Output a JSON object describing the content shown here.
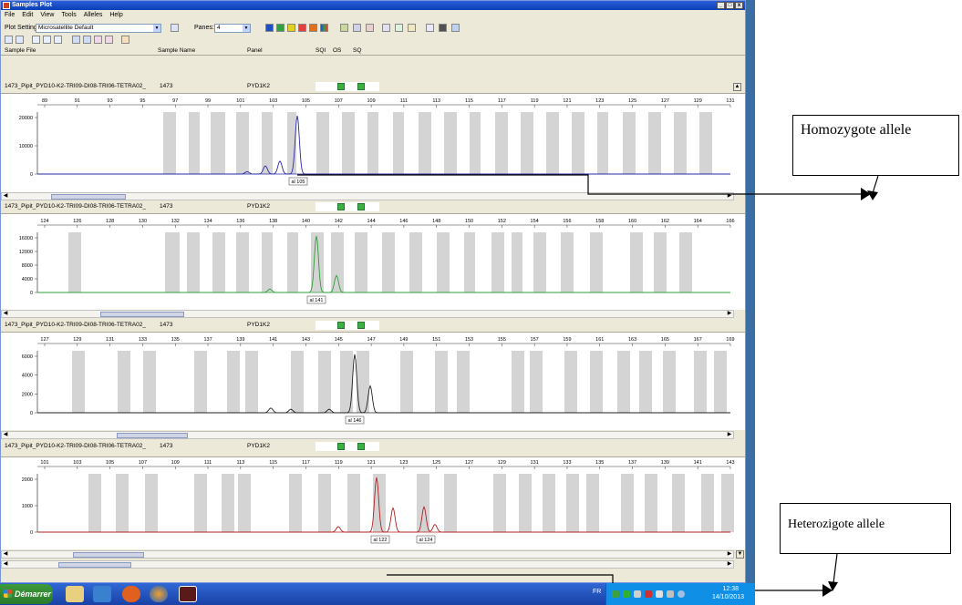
{
  "window": {
    "title": "Samples Plot",
    "buttons": {
      "minimize": "_",
      "maximize": "□",
      "close": "x"
    }
  },
  "menu": [
    "File",
    "Edit",
    "View",
    "Tools",
    "Alleles",
    "Help"
  ],
  "toolbar": {
    "plot_setting_label": "Plot Setting:",
    "plot_setting_value": "Microsatellite Default",
    "panes_label": "Panes:",
    "panes_value": "4"
  },
  "columns": {
    "sample_file": "Sample File",
    "sample_name": "Sample Name",
    "panel": "Panel",
    "sqi": "SQI",
    "os": "OS",
    "sq": "SQ"
  },
  "panes": [
    {
      "sample_file": "1473_Pipit_PYD10-K2-TRI09-DI08-TRI06-TETRA02_",
      "sample_name": "1473",
      "panel": "PYD1K2",
      "color": "#2a2aa8",
      "x_ticks": [
        "89",
        "91",
        "93",
        "95",
        "97",
        "99",
        "101",
        "103",
        "105",
        "107",
        "109",
        "111",
        "113",
        "115",
        "117",
        "119",
        "121",
        "123",
        "125",
        "127",
        "129",
        "131"
      ],
      "y_ticks": [
        "20000",
        "10000",
        "0"
      ],
      "alleles": [
        "105"
      ]
    },
    {
      "sample_file": "1473_Pipit_PYD10-K2-TRI09-DI08-TRI06-TETRA02_",
      "sample_name": "1473",
      "panel": "PYD1K2",
      "color": "#2e9e3a",
      "x_ticks": [
        "124",
        "126",
        "128",
        "130",
        "132",
        "134",
        "136",
        "138",
        "140",
        "142",
        "144",
        "146",
        "148",
        "150",
        "152",
        "154",
        "156",
        "158",
        "160",
        "162",
        "164",
        "166"
      ],
      "y_ticks": [
        "16000",
        "12000",
        "8000",
        "4000",
        "0"
      ],
      "alleles": [
        "141"
      ]
    },
    {
      "sample_file": "1473_Pipit_PYD10-K2-TRI09-DI08-TRI06-TETRA02_",
      "sample_name": "1473",
      "panel": "PYD1K2",
      "color": "#222222",
      "x_ticks": [
        "127",
        "129",
        "131",
        "133",
        "135",
        "137",
        "139",
        "141",
        "143",
        "145",
        "147",
        "149",
        "151",
        "153",
        "155",
        "157",
        "159",
        "161",
        "163",
        "165",
        "167",
        "169"
      ],
      "y_ticks": [
        "6000",
        "4000",
        "2000",
        "0"
      ],
      "alleles": [
        "146"
      ]
    },
    {
      "sample_file": "1473_Pipit_PYD10-K2-TRI09-DI08-TRI06-TETRA02_",
      "sample_name": "1473",
      "panel": "PYD1K2",
      "color": "#b02020",
      "x_ticks": [
        "101",
        "103",
        "105",
        "107",
        "109",
        "111",
        "113",
        "115",
        "117",
        "119",
        "121",
        "123",
        "125",
        "127",
        "129",
        "131",
        "133",
        "135",
        "137",
        "139",
        "141",
        "143"
      ],
      "y_ticks": [
        "2000",
        "1000",
        "0"
      ],
      "alleles": [
        "122",
        "124"
      ]
    }
  ],
  "annotations": {
    "homozygote": "Homozygote allele",
    "heterozygote": "Heterozigote allele"
  },
  "taskbar": {
    "start": "Démarrer",
    "lang": "FR",
    "time": "12:38",
    "date": "14/10/2013"
  }
}
